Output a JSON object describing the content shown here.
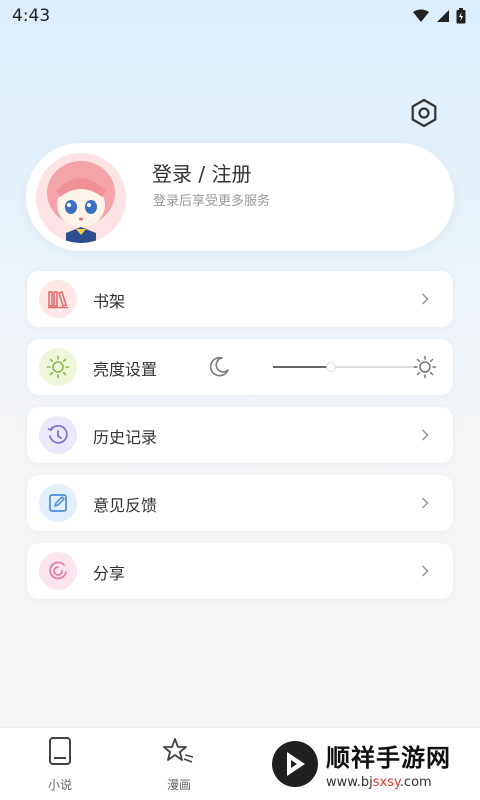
{
  "status_bar": {
    "time": "4:43"
  },
  "profile": {
    "title": "登录 / 注册",
    "subtitle": "登录后享受更多服务"
  },
  "menu": {
    "items": [
      {
        "label": "书架",
        "icon": "bookshelf-icon",
        "icon_color": "#f08a8a",
        "icon_bg": "#fde7e7"
      },
      {
        "label": "亮度设置",
        "icon": "sun-icon",
        "icon_color": "#8fb84a",
        "icon_bg": "#eef7dc"
      },
      {
        "label": "历史记录",
        "icon": "history-icon",
        "icon_color": "#7a6fd1",
        "icon_bg": "#ebe8fb"
      },
      {
        "label": "意见反馈",
        "icon": "feedback-icon",
        "icon_color": "#4a8fd6",
        "icon_bg": "#e2eefb"
      },
      {
        "label": "分享",
        "icon": "share-icon",
        "icon_color": "#e47aa6",
        "icon_bg": "#fbe6ef"
      }
    ],
    "brightness_level": 0.4
  },
  "bottom_nav": {
    "tabs": [
      {
        "label": "小说",
        "icon": "book-icon"
      },
      {
        "label": "漫画",
        "icon": "comic-star-icon"
      }
    ]
  },
  "watermark": {
    "title": "顺祥手游网",
    "url_prefix": "www.bj",
    "url_highlight": "sxsy",
    "url_suffix": ".com"
  }
}
